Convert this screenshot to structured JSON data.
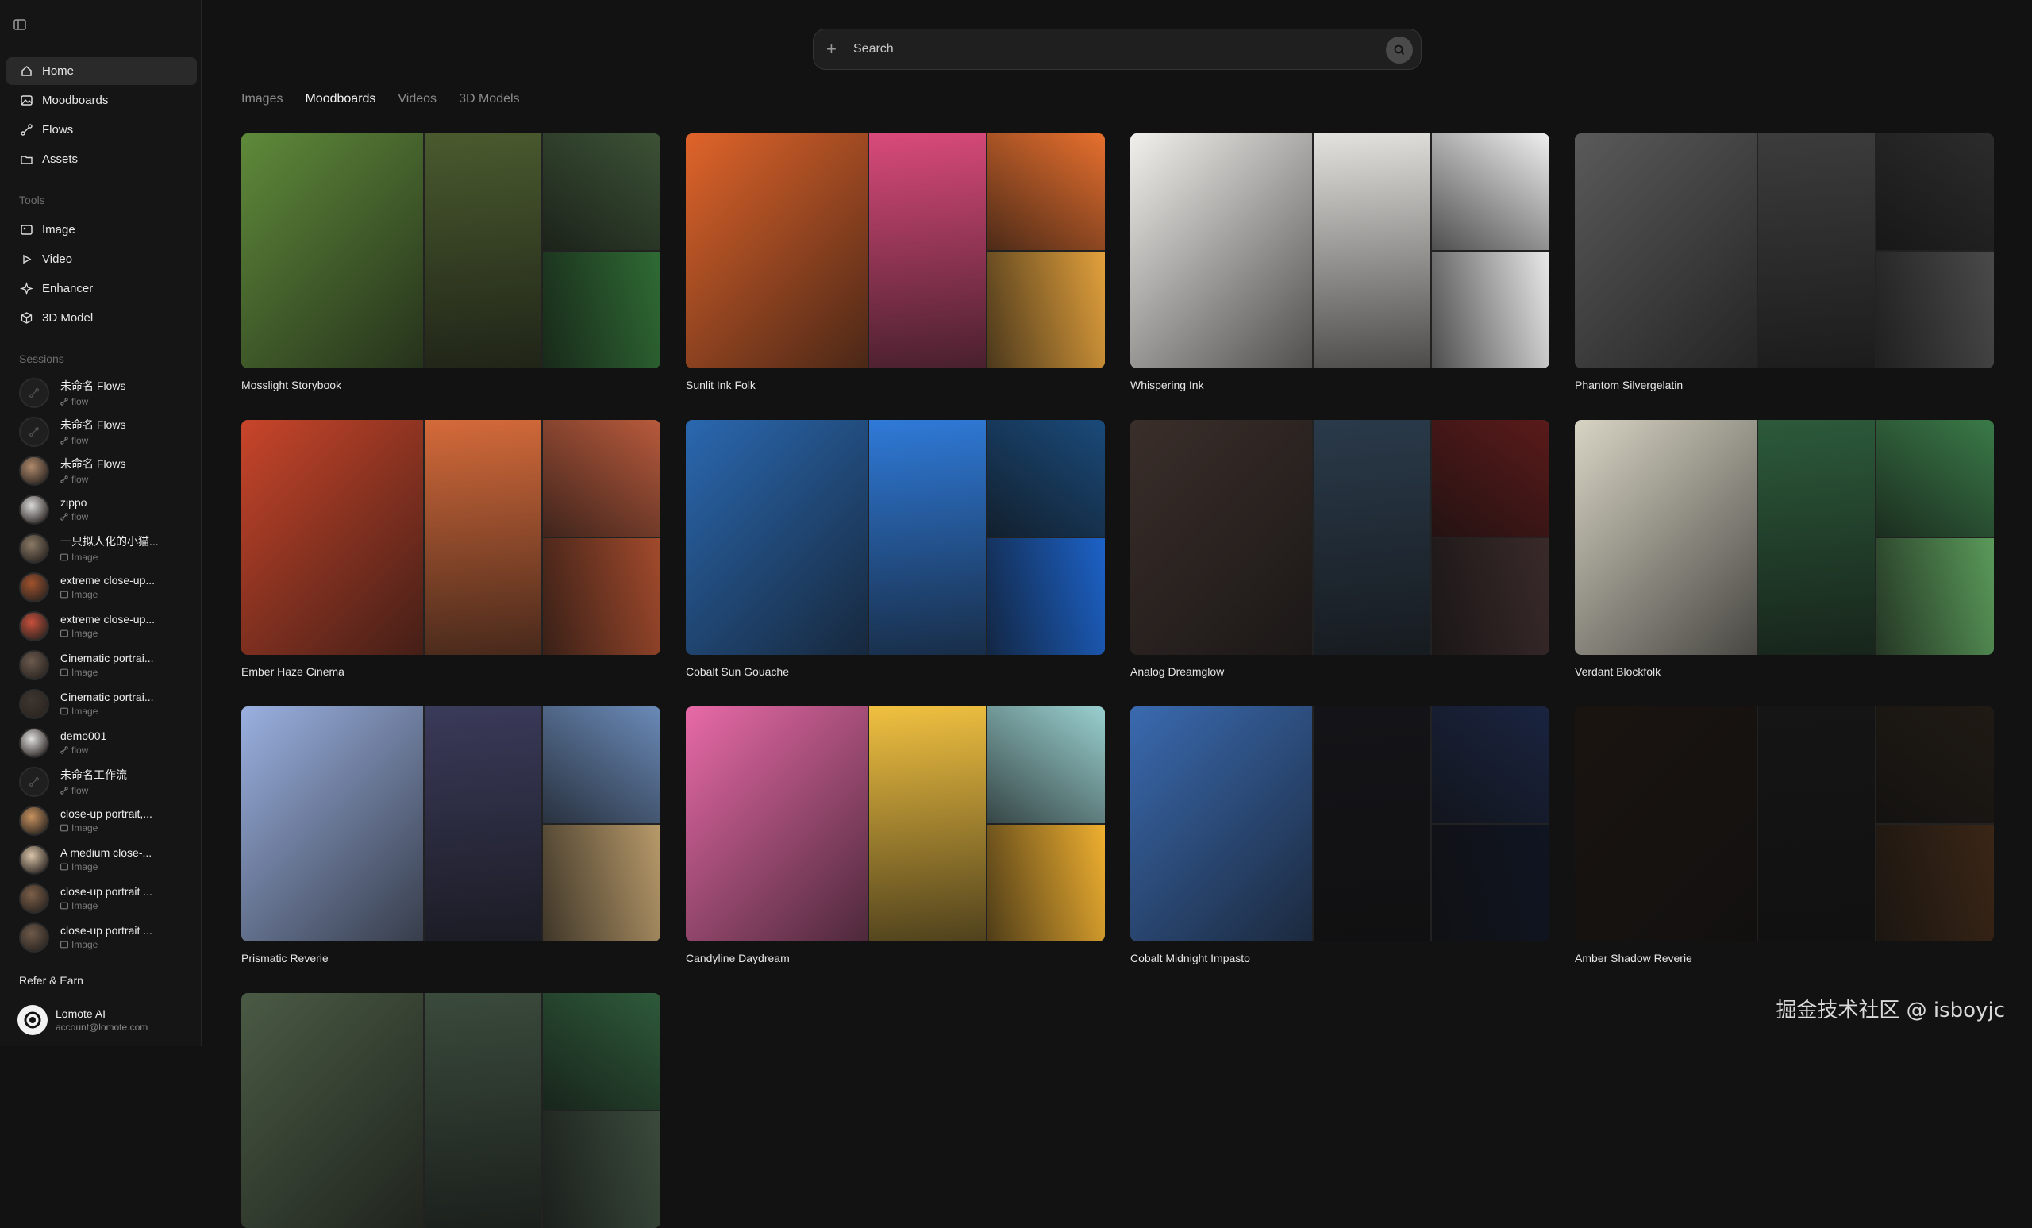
{
  "nav": [
    {
      "label": "Home",
      "icon": "home-icon",
      "active": true
    },
    {
      "label": "Moodboards",
      "icon": "image-icon"
    },
    {
      "label": "Flows",
      "icon": "flow-icon"
    },
    {
      "label": "Assets",
      "icon": "folder-icon"
    }
  ],
  "tools_label": "Tools",
  "tools": [
    {
      "label": "Image",
      "icon": "image-icon"
    },
    {
      "label": "Video",
      "icon": "video-icon"
    },
    {
      "label": "Enhancer",
      "icon": "sparkle-icon"
    },
    {
      "label": "3D Model",
      "icon": "cube-icon"
    }
  ],
  "sessions_label": "Sessions",
  "sessions": [
    {
      "title": "未命名 Flows",
      "type": "flow",
      "thumb": "empty"
    },
    {
      "title": "未命名 Flows",
      "type": "flow",
      "thumb": "empty"
    },
    {
      "title": "未命名 Flows",
      "type": "flow",
      "thumb": "photo",
      "color": "#b08a6c"
    },
    {
      "title": "zippo",
      "type": "flow",
      "thumb": "photo",
      "color": "#d9d9d9"
    },
    {
      "title": "一只拟人化的小猫...",
      "type": "Image",
      "thumb": "photo",
      "color": "#8a7a66"
    },
    {
      "title": "extreme close-up...",
      "type": "Image",
      "thumb": "photo",
      "color": "#a0522d"
    },
    {
      "title": "extreme close-up...",
      "type": "Image",
      "thumb": "photo",
      "color": "#c8503c"
    },
    {
      "title": "Cinematic portrai...",
      "type": "Image",
      "thumb": "photo",
      "color": "#6b5a4e"
    },
    {
      "title": "Cinematic portrai...",
      "type": "Image",
      "thumb": "photo",
      "color": "#3e3630"
    },
    {
      "title": "demo001",
      "type": "flow",
      "thumb": "photo",
      "color": "#e0e0e0"
    },
    {
      "title": "未命名工作流",
      "type": "flow",
      "thumb": "empty"
    },
    {
      "title": "close-up portrait,...",
      "type": "Image",
      "thumb": "photo",
      "color": "#c7925f"
    },
    {
      "title": "A medium close-...",
      "type": "Image",
      "thumb": "photo",
      "color": "#d8c3a8"
    },
    {
      "title": "close-up portrait ...",
      "type": "Image",
      "thumb": "photo",
      "color": "#7c5f48"
    },
    {
      "title": "close-up portrait ...",
      "type": "Image",
      "thumb": "photo",
      "color": "#6e5a4a"
    }
  ],
  "refer_label": "Refer & Earn",
  "account": {
    "name": "Lomote AI",
    "email": "account@lomote.com"
  },
  "search": {
    "placeholder": "Search"
  },
  "tabs": [
    {
      "label": "Images"
    },
    {
      "label": "Moodboards",
      "active": true
    },
    {
      "label": "Videos"
    },
    {
      "label": "3D Models"
    }
  ],
  "moodboards": [
    {
      "title": "Mosslight Storybook",
      "colors": [
        "#5f8a3a",
        "#4a5a2e",
        "#3c5236",
        "#2f6b34"
      ]
    },
    {
      "title": "Sunlit Ink Folk",
      "colors": [
        "#e0642a",
        "#d94a7a",
        "#e8702e",
        "#e3a13c"
      ]
    },
    {
      "title": "Whispering Ink",
      "colors": [
        "#f2f0ec",
        "#e4e2de",
        "#efefef",
        "#e9e9e9"
      ]
    },
    {
      "title": "Phantom Silvergelatin",
      "colors": [
        "#5a5a5a",
        "#3c3c3c",
        "#2c2c2c",
        "#4a4a4a"
      ]
    },
    {
      "title": "Ember Haze Cinema",
      "colors": [
        "#c8452a",
        "#d46a3a",
        "#b85a3c",
        "#a24a2c"
      ]
    },
    {
      "title": "Cobalt Sun Gouache",
      "colors": [
        "#2a68b0",
        "#2f7ad8",
        "#1a4a7a",
        "#1c62c8"
      ]
    },
    {
      "title": "Analog Dreamglow",
      "colors": [
        "#3a2e2a",
        "#2a3a4a",
        "#5a1a1a",
        "#3a2a2a"
      ]
    },
    {
      "title": "Verdant Blockfolk",
      "colors": [
        "#d8d4c4",
        "#2c5a3a",
        "#3a7a48",
        "#5a9a5a"
      ]
    },
    {
      "title": "Prismatic Reverie",
      "colors": [
        "#9ab0e0",
        "#3a3a5a",
        "#6a8ab8",
        "#b89a6a"
      ]
    },
    {
      "title": "Candyline Daydream",
      "colors": [
        "#e86aa8",
        "#f0c040",
        "#9ad0d0",
        "#f0b030"
      ]
    },
    {
      "title": "Cobalt Midnight Impasto",
      "colors": [
        "#3a6ab0",
        "#141418",
        "#1a2440",
        "#101522"
      ]
    },
    {
      "title": "Amber Shadow Reverie",
      "colors": [
        "#1a1410",
        "#151515",
        "#201a14",
        "#3a2616"
      ]
    },
    {
      "title": "",
      "colors": [
        "#4a5a44",
        "#3a4a3c",
        "#2e5a3a",
        "#3a4a3c"
      ]
    }
  ],
  "watermark": "掘金技术社区 @ isboyjc"
}
